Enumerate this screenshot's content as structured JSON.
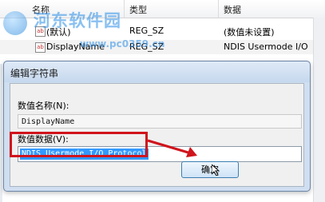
{
  "registry_list": {
    "columns": [
      "名称",
      "类型",
      "数据"
    ],
    "rows": [
      {
        "name": "(默认)",
        "type": "REG_SZ",
        "data": "(数值未设置)"
      },
      {
        "name": "DisplayName",
        "type": "REG_SZ",
        "data": "NDIS Usermode I/O"
      }
    ],
    "icon": "string-value-icon",
    "partial_row_hint": "st"
  },
  "watermark": {
    "text": "河东软件园",
    "url": "www.pc0359.cn"
  },
  "dialog": {
    "title": "编辑字符串",
    "name_label": "数值名称(N):",
    "name_value": "DisplayName",
    "data_label": "数值数据(V):",
    "data_value": "NDIS Usermode I/O Protocol",
    "ok_label": "确定"
  },
  "colors": {
    "highlight": "#d0141c",
    "selection": "#3399ff",
    "dialog_frame": "#cfdef0"
  }
}
